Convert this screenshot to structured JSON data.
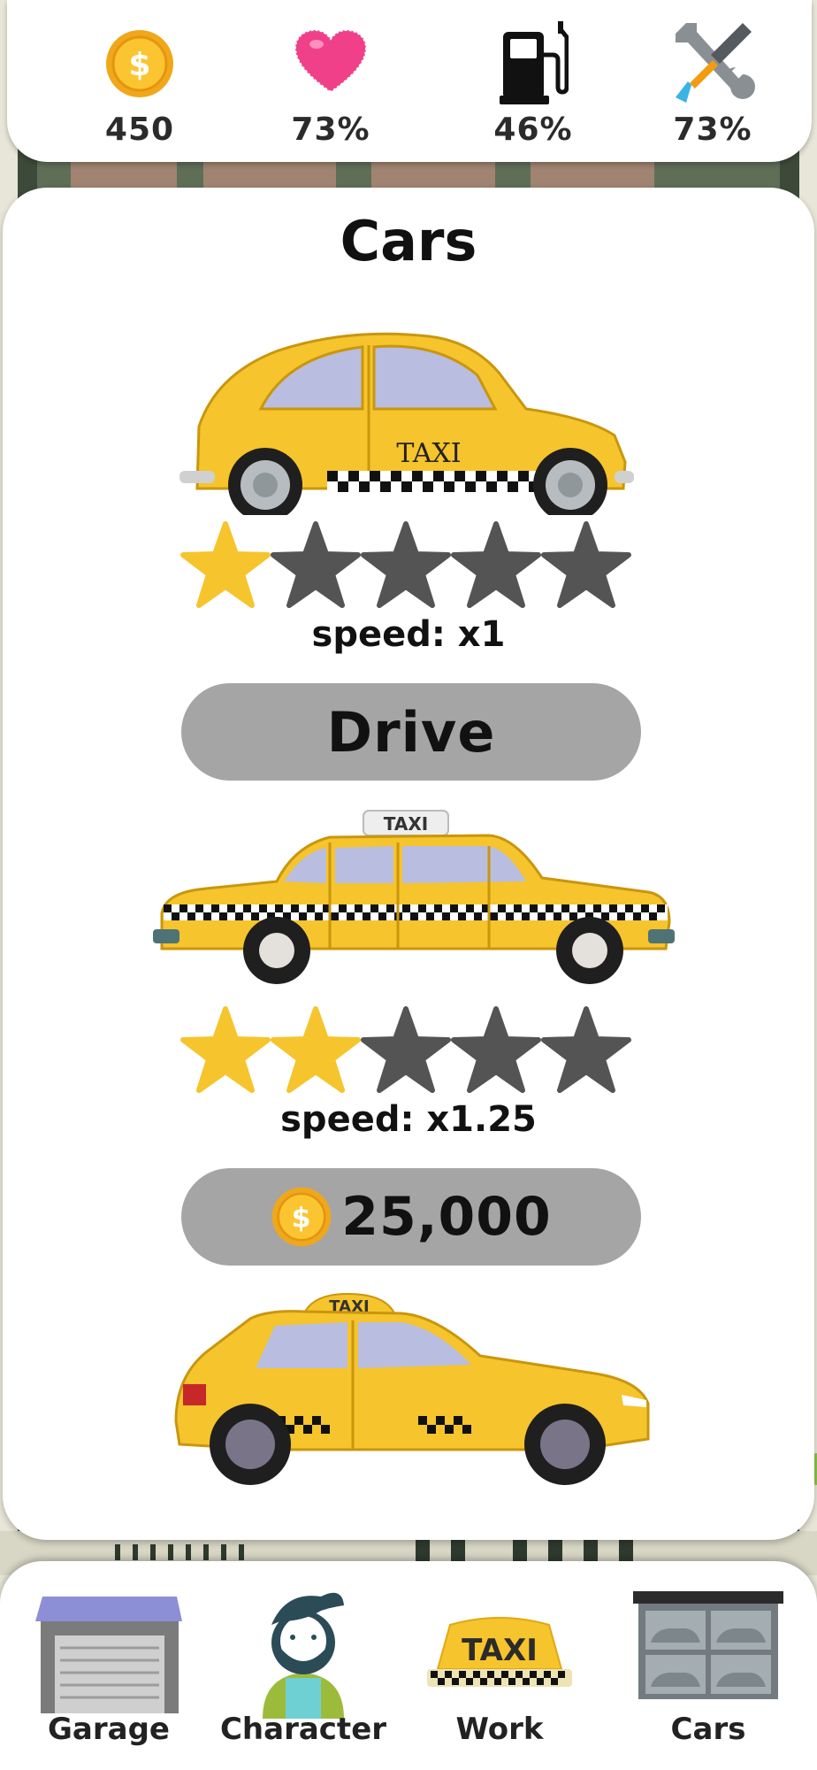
{
  "stats": {
    "coins": "450",
    "health": "73%",
    "fuel": "46%",
    "repair": "73%"
  },
  "panel": {
    "title": "Cars",
    "cars": [
      {
        "name": "beetle-taxi",
        "roof_text": "",
        "door_text": "TAXI",
        "stars_filled": 1,
        "stars_total": 5,
        "speed": "speed: x1",
        "action": {
          "type": "drive",
          "label": "Drive"
        }
      },
      {
        "name": "sedan-taxi",
        "roof_text": "TAXI",
        "stars_filled": 2,
        "stars_total": 5,
        "speed": "speed: x1.25",
        "action": {
          "type": "buy",
          "price": "25,000"
        }
      },
      {
        "name": "hatchback-taxi",
        "roof_text": "TAXI"
      }
    ]
  },
  "nav": {
    "items": [
      {
        "label": "Garage",
        "icon": "garage-icon"
      },
      {
        "label": "Character",
        "icon": "character-icon"
      },
      {
        "label": "Work",
        "icon": "taxi-sign-icon",
        "sign_text": "TAXI"
      },
      {
        "label": "Cars",
        "icon": "car-showroom-icon"
      }
    ]
  },
  "colors": {
    "accent_yellow": "#f6c42c",
    "star_empty": "#545454",
    "button_gray": "#a5a5a5",
    "heart_pink": "#f0408a"
  }
}
